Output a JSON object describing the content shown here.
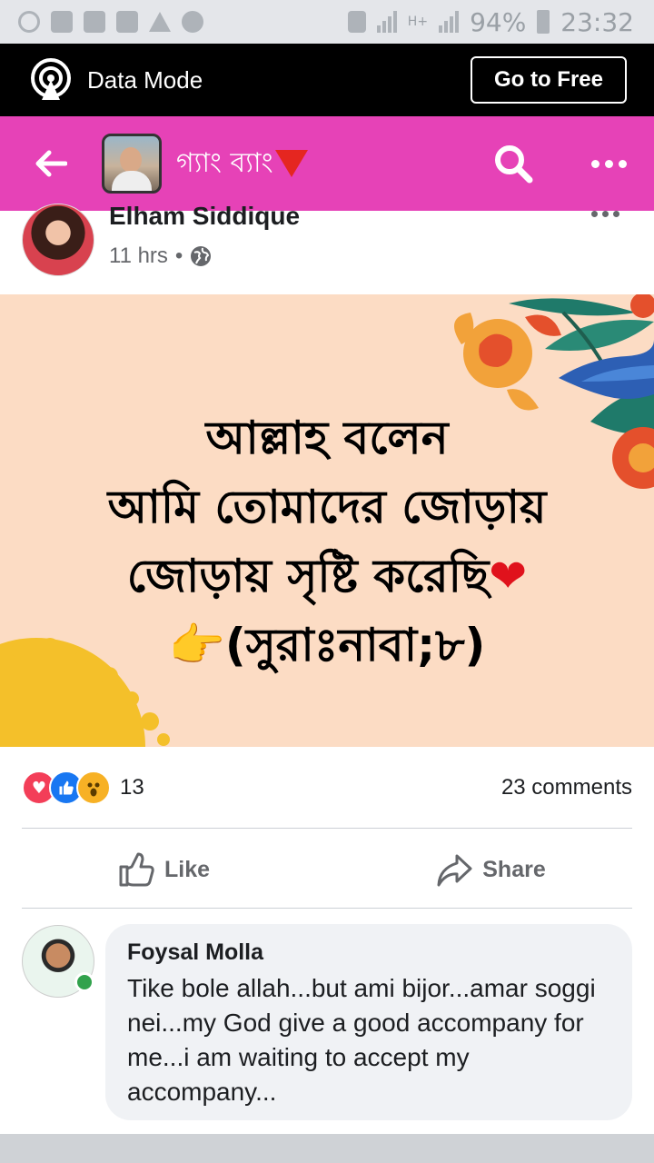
{
  "status_bar": {
    "battery": "94%",
    "time": "23:32",
    "network": "H+",
    "sim": "1"
  },
  "data_mode": {
    "label": "Data Mode",
    "button": "Go to Free"
  },
  "header": {
    "group_name": "গ্যাং ব্যাং",
    "accent_color": "#e642b7",
    "icons": [
      "back-arrow-icon",
      "search-icon",
      "more-icon"
    ]
  },
  "post": {
    "author": "Elham Siddique",
    "time": "11 hrs",
    "separator": "•",
    "image_text": {
      "line1": "আল্লাহ বলেন",
      "line2": "আমি তোমাদের জোড়ায়",
      "line3": "জোড়ায় সৃষ্টি করেছি",
      "heart": "❤",
      "pointer": "👉",
      "line4": "(সুরাঃনাবা;৮)"
    },
    "reaction_count": "13",
    "comment_count": "23 comments",
    "actions": {
      "like": "Like",
      "share": "Share"
    }
  },
  "comment": {
    "name": "Foysal Molla",
    "text": "Tike bole allah...but ami bijor...amar soggi nei...my God give a good accompany  for me...i am waiting to accept my accompany..."
  }
}
